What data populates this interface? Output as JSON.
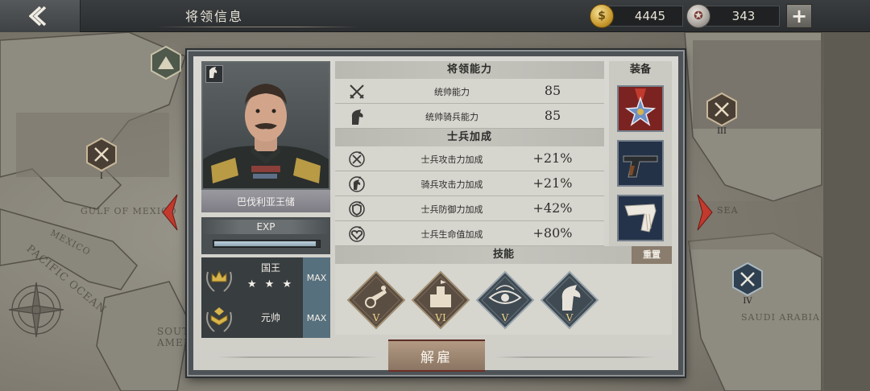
{
  "header": {
    "title": "将领信息",
    "gold": "4445",
    "medals": "343",
    "gold_glyph": "$",
    "medal_glyph": "✪",
    "add_glyph": "+"
  },
  "map": {
    "labels": [
      "GULF OF MEXICO",
      "MEXICO",
      "PACIFIC OCEAN",
      "SOUTH AMERICA",
      "SAUDI ARABIA",
      "SEA"
    ],
    "markers": [
      "I",
      "III",
      "IV"
    ]
  },
  "general": {
    "name": "巴伐利亚王储",
    "exp_label": "EXP",
    "exp_progress": 0.97,
    "nobility": {
      "title": "国王",
      "stars": "★ ★ ★",
      "max": "MAX"
    },
    "military": {
      "title": "元帅",
      "max": "MAX"
    }
  },
  "abilities": {
    "header": "将领能力",
    "rows": [
      {
        "icon": "crossed-swords-icon",
        "label": "统帅能力",
        "value": "85"
      },
      {
        "icon": "horse-head-icon",
        "label": "统帅骑兵能力",
        "value": "85"
      }
    ]
  },
  "bonuses": {
    "header": "士兵加成",
    "rows": [
      {
        "icon": "attack-up-icon",
        "label": "士兵攻击力加成",
        "value": "+21%"
      },
      {
        "icon": "cavalry-attack-up-icon",
        "label": "骑兵攻击力加成",
        "value": "+21%"
      },
      {
        "icon": "defense-up-icon",
        "label": "士兵防御力加成",
        "value": "+42%"
      },
      {
        "icon": "health-up-icon",
        "label": "士兵生命值加成",
        "value": "+80%"
      }
    ]
  },
  "equipment": {
    "header": "装备",
    "items": [
      "medal-star-icon",
      "pistol-icon",
      "scarf-icon"
    ]
  },
  "skills": {
    "header": "技能",
    "reset_label": "重置",
    "items": [
      {
        "icon": "artillery-skill-icon",
        "level": "V",
        "color": "#5a4d42"
      },
      {
        "icon": "fortress-skill-icon",
        "level": "VI",
        "color": "#5a4d42"
      },
      {
        "icon": "eye-skill-icon",
        "level": "V",
        "color": "#3f4a52"
      },
      {
        "icon": "horse-skill-icon",
        "level": "V",
        "color": "#3f4a52"
      }
    ]
  },
  "actions": {
    "dismiss_label": "解雇"
  },
  "colors": {
    "max_badge": "#57707e",
    "dismiss_border": "#6e2f27",
    "skill_level": "#f0d48a"
  }
}
